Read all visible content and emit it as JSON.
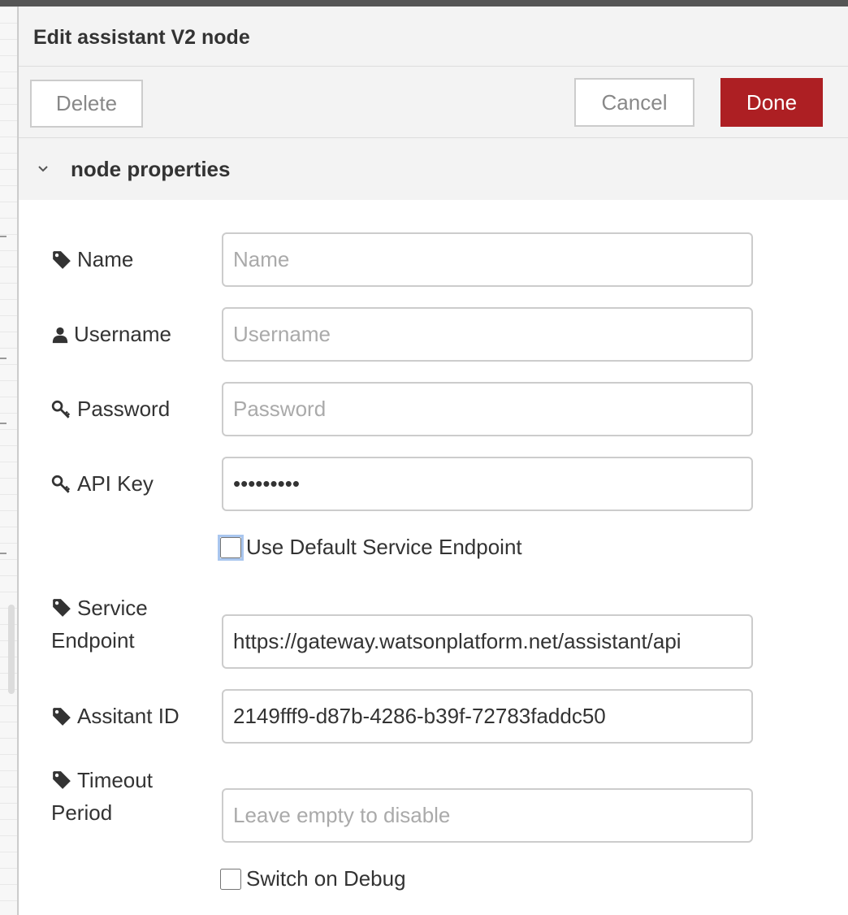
{
  "tray": {
    "title": "Edit assistant V2 node",
    "delete_label": "Delete",
    "cancel_label": "Cancel",
    "done_label": "Done"
  },
  "section": {
    "title": "node properties",
    "expanded": true
  },
  "fields": {
    "name": {
      "label": "Name",
      "placeholder": "Name",
      "value": "",
      "icon": "tag-icon"
    },
    "username": {
      "label": "Username",
      "placeholder": "Username",
      "value": "",
      "icon": "user-icon"
    },
    "password": {
      "label": "Password",
      "placeholder": "Password",
      "value": "",
      "icon": "key-icon"
    },
    "api_key": {
      "label": "API Key",
      "value": "•••••••••",
      "icon": "key-icon"
    },
    "use_default_endpoint": {
      "label": "Use Default Service Endpoint",
      "checked": false
    },
    "service_endpoint": {
      "label_line1": "Service",
      "label_line2": "Endpoint",
      "value": "https://gateway.watsonplatform.net/assistant/api",
      "icon": "tag-icon"
    },
    "assistant_id": {
      "label": "Assitant ID",
      "value": "2149fff9-d87b-4286-b39f-72783faddc50",
      "icon": "tag-icon"
    },
    "timeout_period": {
      "label_line1": "Timeout",
      "label_line2": "Period",
      "placeholder": "Leave empty to disable",
      "value": "",
      "icon": "tag-icon"
    },
    "debug": {
      "label": "Switch on Debug",
      "checked": false
    }
  },
  "colors": {
    "done_button": "#ad1f23",
    "header_bg": "#f3f3f3",
    "field_border": "#cccccc",
    "focus_ring": "#a9c6ef"
  }
}
